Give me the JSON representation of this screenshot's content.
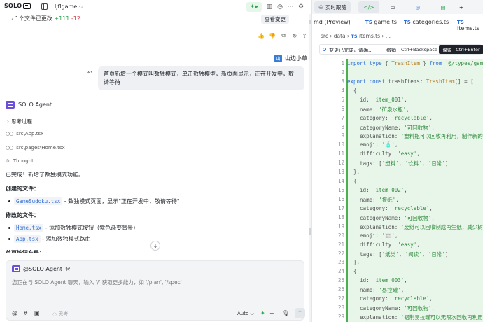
{
  "app": {
    "logo_text": "SOLO",
    "project_name": "ljflgame"
  },
  "top": {
    "changed_text": "1个文件已更改",
    "added": "+111",
    "removed": "-12",
    "review_label": "查看变更"
  },
  "chat": {
    "user_name": "山边小草",
    "user_avatar": "山",
    "user_message": "首页新增一个模式叫数独模式，单击数独模型，新页面显示，正在开发中，敬请等待",
    "agent_name": "SOLO Agent",
    "thinking_label": "思考过程",
    "tools": [
      "src\\App.tsx",
      "src\\pages\\Home.tsx"
    ],
    "thought_label": "Thought",
    "done_text": "已完成！新增了数独模式功能。",
    "created_heading": "创建的文件：",
    "created_items": [
      {
        "file": "GameSudoku.tsx",
        "desc": " - 数独模式页面，显示\"正在开发中，敬请等待\""
      }
    ],
    "modified_heading": "修改的文件：",
    "modified_items": [
      {
        "file": "Home.tsx",
        "desc": " - 添加数独模式按钮（紫色渐变背景）"
      },
      {
        "file": "App.tsx",
        "desc": " - 添加数独模式路由"
      }
    ],
    "cut_heading": "首页按钮布局："
  },
  "composer": {
    "agent_label": "@SOLO Agent",
    "placeholder": "您正在与 SOLO Agent 聊天，输入 '/' 获取更多能力，如 '/plan', '/spec'",
    "think_label": "思考",
    "mode_label": "Auto"
  },
  "right": {
    "realtime_label": "实时跟随",
    "tabs": [
      {
        "label": "md (Preview)",
        "ts": ""
      },
      {
        "label": "game.ts",
        "ts": "TS"
      },
      {
        "label": "categories.ts",
        "ts": "TS"
      },
      {
        "label": "items.ts",
        "ts": "TS"
      }
    ],
    "breadcrumb": [
      "src",
      "data",
      "items.ts",
      "..."
    ],
    "breadcrumb_ts": "TS",
    "change_text": "变更已完成，请确...",
    "undo_label": "撤销",
    "undo_key": "Ctrl+Backspace",
    "keep_label": "保留",
    "keep_key": "Ctrl+Enter"
  },
  "code": {
    "start_line": 1,
    "lines": [
      [
        [
          "kw",
          "import type"
        ],
        [
          "pu",
          " { "
        ],
        [
          "ty",
          "TrashItem"
        ],
        [
          "pu",
          " } "
        ],
        [
          "kw",
          "from"
        ],
        [
          "str",
          " '@/types/gam"
        ]
      ],
      [],
      [
        [
          "kw",
          "export const"
        ],
        [
          "pu",
          " trashItems: "
        ],
        [
          "ty",
          "TrashItem"
        ],
        [
          "pu",
          "[] = ["
        ]
      ],
      [
        [
          "pu",
          "  {"
        ]
      ],
      [
        [
          "pu",
          "    id: "
        ],
        [
          "str",
          "'item_001'"
        ],
        [
          "pu",
          ","
        ]
      ],
      [
        [
          "pu",
          "    name: "
        ],
        [
          "str",
          "'矿泉水瓶'"
        ],
        [
          "pu",
          ","
        ]
      ],
      [
        [
          "pu",
          "    category: "
        ],
        [
          "str",
          "'recyclable'"
        ],
        [
          "pu",
          ","
        ]
      ],
      [
        [
          "pu",
          "    categoryName: "
        ],
        [
          "str",
          "'可回收物'"
        ],
        [
          "pu",
          ","
        ]
      ],
      [
        [
          "pu",
          "    explanation: "
        ],
        [
          "str",
          "'塑料瓶可以回收再利用，制作新的"
        ]
      ],
      [
        [
          "pu",
          "    emoji: "
        ],
        [
          "str",
          "'🧴'"
        ],
        [
          "pu",
          ","
        ]
      ],
      [
        [
          "pu",
          "    difficulty: "
        ],
        [
          "str",
          "'easy'"
        ],
        [
          "pu",
          ","
        ]
      ],
      [
        [
          "pu",
          "    tags: ["
        ],
        [
          "str",
          "'塑料'"
        ],
        [
          "pu",
          ", "
        ],
        [
          "str",
          "'饮料'"
        ],
        [
          "pu",
          ", "
        ],
        [
          "str",
          "'日常'"
        ],
        [
          "pu",
          "]"
        ]
      ],
      [
        [
          "pu",
          "  },"
        ]
      ],
      [
        [
          "pu",
          "  {"
        ]
      ],
      [
        [
          "pu",
          "    id: "
        ],
        [
          "str",
          "'item_002'"
        ],
        [
          "pu",
          ","
        ]
      ],
      [
        [
          "pu",
          "    name: "
        ],
        [
          "str",
          "'报纸'"
        ],
        [
          "pu",
          ","
        ]
      ],
      [
        [
          "pu",
          "    category: "
        ],
        [
          "str",
          "'recyclable'"
        ],
        [
          "pu",
          ","
        ]
      ],
      [
        [
          "pu",
          "    categoryName: "
        ],
        [
          "str",
          "'可回收物'"
        ],
        [
          "pu",
          ","
        ]
      ],
      [
        [
          "pu",
          "    explanation: "
        ],
        [
          "str",
          "'废纸可以回收制成再生纸，减少树"
        ]
      ],
      [
        [
          "pu",
          "    emoji: "
        ],
        [
          "str",
          "'📰'"
        ],
        [
          "pu",
          ","
        ]
      ],
      [
        [
          "pu",
          "    difficulty: "
        ],
        [
          "str",
          "'easy'"
        ],
        [
          "pu",
          ","
        ]
      ],
      [
        [
          "pu",
          "    tags: ["
        ],
        [
          "str",
          "'纸类'"
        ],
        [
          "pu",
          ", "
        ],
        [
          "str",
          "'阅读'"
        ],
        [
          "pu",
          ", "
        ],
        [
          "str",
          "'日常'"
        ],
        [
          "pu",
          "]"
        ]
      ],
      [
        [
          "pu",
          "  },"
        ]
      ],
      [
        [
          "pu",
          "  {"
        ]
      ],
      [
        [
          "pu",
          "    id: "
        ],
        [
          "str",
          "'item_003'"
        ],
        [
          "pu",
          ","
        ]
      ],
      [
        [
          "pu",
          "    name: "
        ],
        [
          "str",
          "'易拉罐'"
        ],
        [
          "pu",
          ","
        ]
      ],
      [
        [
          "pu",
          "    category: "
        ],
        [
          "str",
          "'recyclable'"
        ],
        [
          "pu",
          ","
        ]
      ],
      [
        [
          "pu",
          "    categoryName: "
        ],
        [
          "str",
          "'可回收物'"
        ],
        [
          "pu",
          ","
        ]
      ],
      [
        [
          "pu",
          "    explanation: "
        ],
        [
          "str",
          "'铝制易拉罐可以无限次回收再利用"
        ]
      ]
    ]
  }
}
